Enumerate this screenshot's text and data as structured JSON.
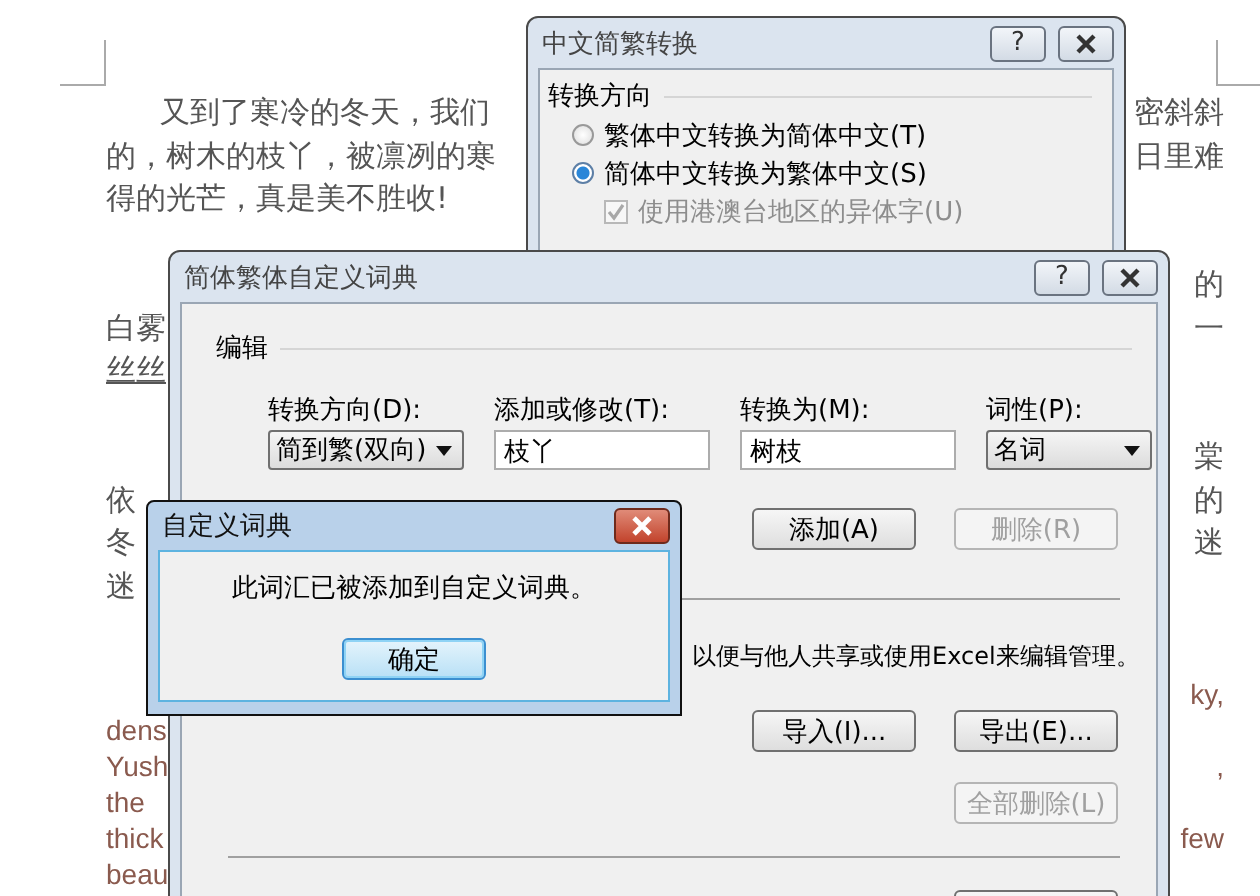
{
  "document": {
    "paragraphs": [
      {
        "kind": "cjk",
        "lines": [
          {
            "left": "又到了寒冷的冬天，我们",
            "indented": true,
            "underlined": false,
            "right": "密斜斜"
          },
          {
            "left": "的，树木的枝丫，被凛冽的寒",
            "indented": false,
            "underlined": false,
            "right": "日里难"
          },
          {
            "left": "得的光芒，真是美不胜收!",
            "indented": false,
            "underlined": false
          }
        ]
      },
      {
        "kind": "cjk",
        "lines": [
          {
            "right": "的"
          },
          {
            "left": "白雾",
            "indented": false,
            "underlined": false,
            "right": "一"
          },
          {
            "left": "丝丝",
            "indented": false,
            "underlined": true
          }
        ]
      },
      {
        "kind": "cjk",
        "lines": [
          {
            "right": "棠"
          },
          {
            "left": "依",
            "indented": false,
            "underlined": false,
            "right": "的"
          },
          {
            "left": "冬",
            "indented": false,
            "underlined": false,
            "right": "迷"
          },
          {
            "left": "迷",
            "indented": false,
            "underlined": false
          }
        ]
      },
      {
        "kind": "latin",
        "lines": [
          {
            "right": "ky,"
          },
          {
            "left": "dens",
            "indented": false,
            "underlined": false
          },
          {
            "left": "Yush",
            "indented": false,
            "underlined": false,
            "right": ","
          },
          {
            "left": "the",
            "indented": false,
            "underlined": false
          },
          {
            "left": "thick",
            "indented": false,
            "underlined": false,
            "right": "few"
          },
          {
            "left": "beau",
            "indented": false,
            "underlined": false
          }
        ]
      }
    ]
  },
  "conversion_dialog": {
    "title": "中文简繁转换",
    "help": "?",
    "direction_group": "转换方向",
    "options": [
      {
        "label": "繁体中文转换为简体中文(T)",
        "selected": false
      },
      {
        "label": "简体中文转换为繁体中文(S)",
        "selected": true
      }
    ],
    "variant_checkbox": {
      "label": "使用港澳台地区的异体字(U)",
      "checked": true,
      "disabled": true
    }
  },
  "dictionary_dialog": {
    "title": "简体繁体自定义词典",
    "help": "?",
    "edit_group": "编辑",
    "fields": [
      {
        "label": "转换方向(D):",
        "kind": "dropdown",
        "value": "简到繁(双向)"
      },
      {
        "label": "添加或修改(T):",
        "kind": "input",
        "value": "枝丫"
      },
      {
        "label": "转换为(M):",
        "kind": "input",
        "value": "树枝"
      },
      {
        "label": "词性(P):",
        "kind": "dropdown",
        "value": "名词"
      }
    ],
    "edit_buttons": [
      {
        "label": "添加(A)",
        "disabled": false
      },
      {
        "label": "删除(R)",
        "disabled": true
      }
    ],
    "note": "以便与他人共享或使用Excel来编辑管理。",
    "file_buttons": [
      {
        "label": "导入(I)...",
        "disabled": false
      },
      {
        "label": "导出(E)...",
        "disabled": false
      }
    ],
    "clear_buttons": [
      {
        "label": "全部删除(L)",
        "disabled": true
      }
    ]
  },
  "message_dialog": {
    "title": "自定义词典",
    "message": "此词汇已被添加到自定义词典。",
    "button": "确定"
  }
}
